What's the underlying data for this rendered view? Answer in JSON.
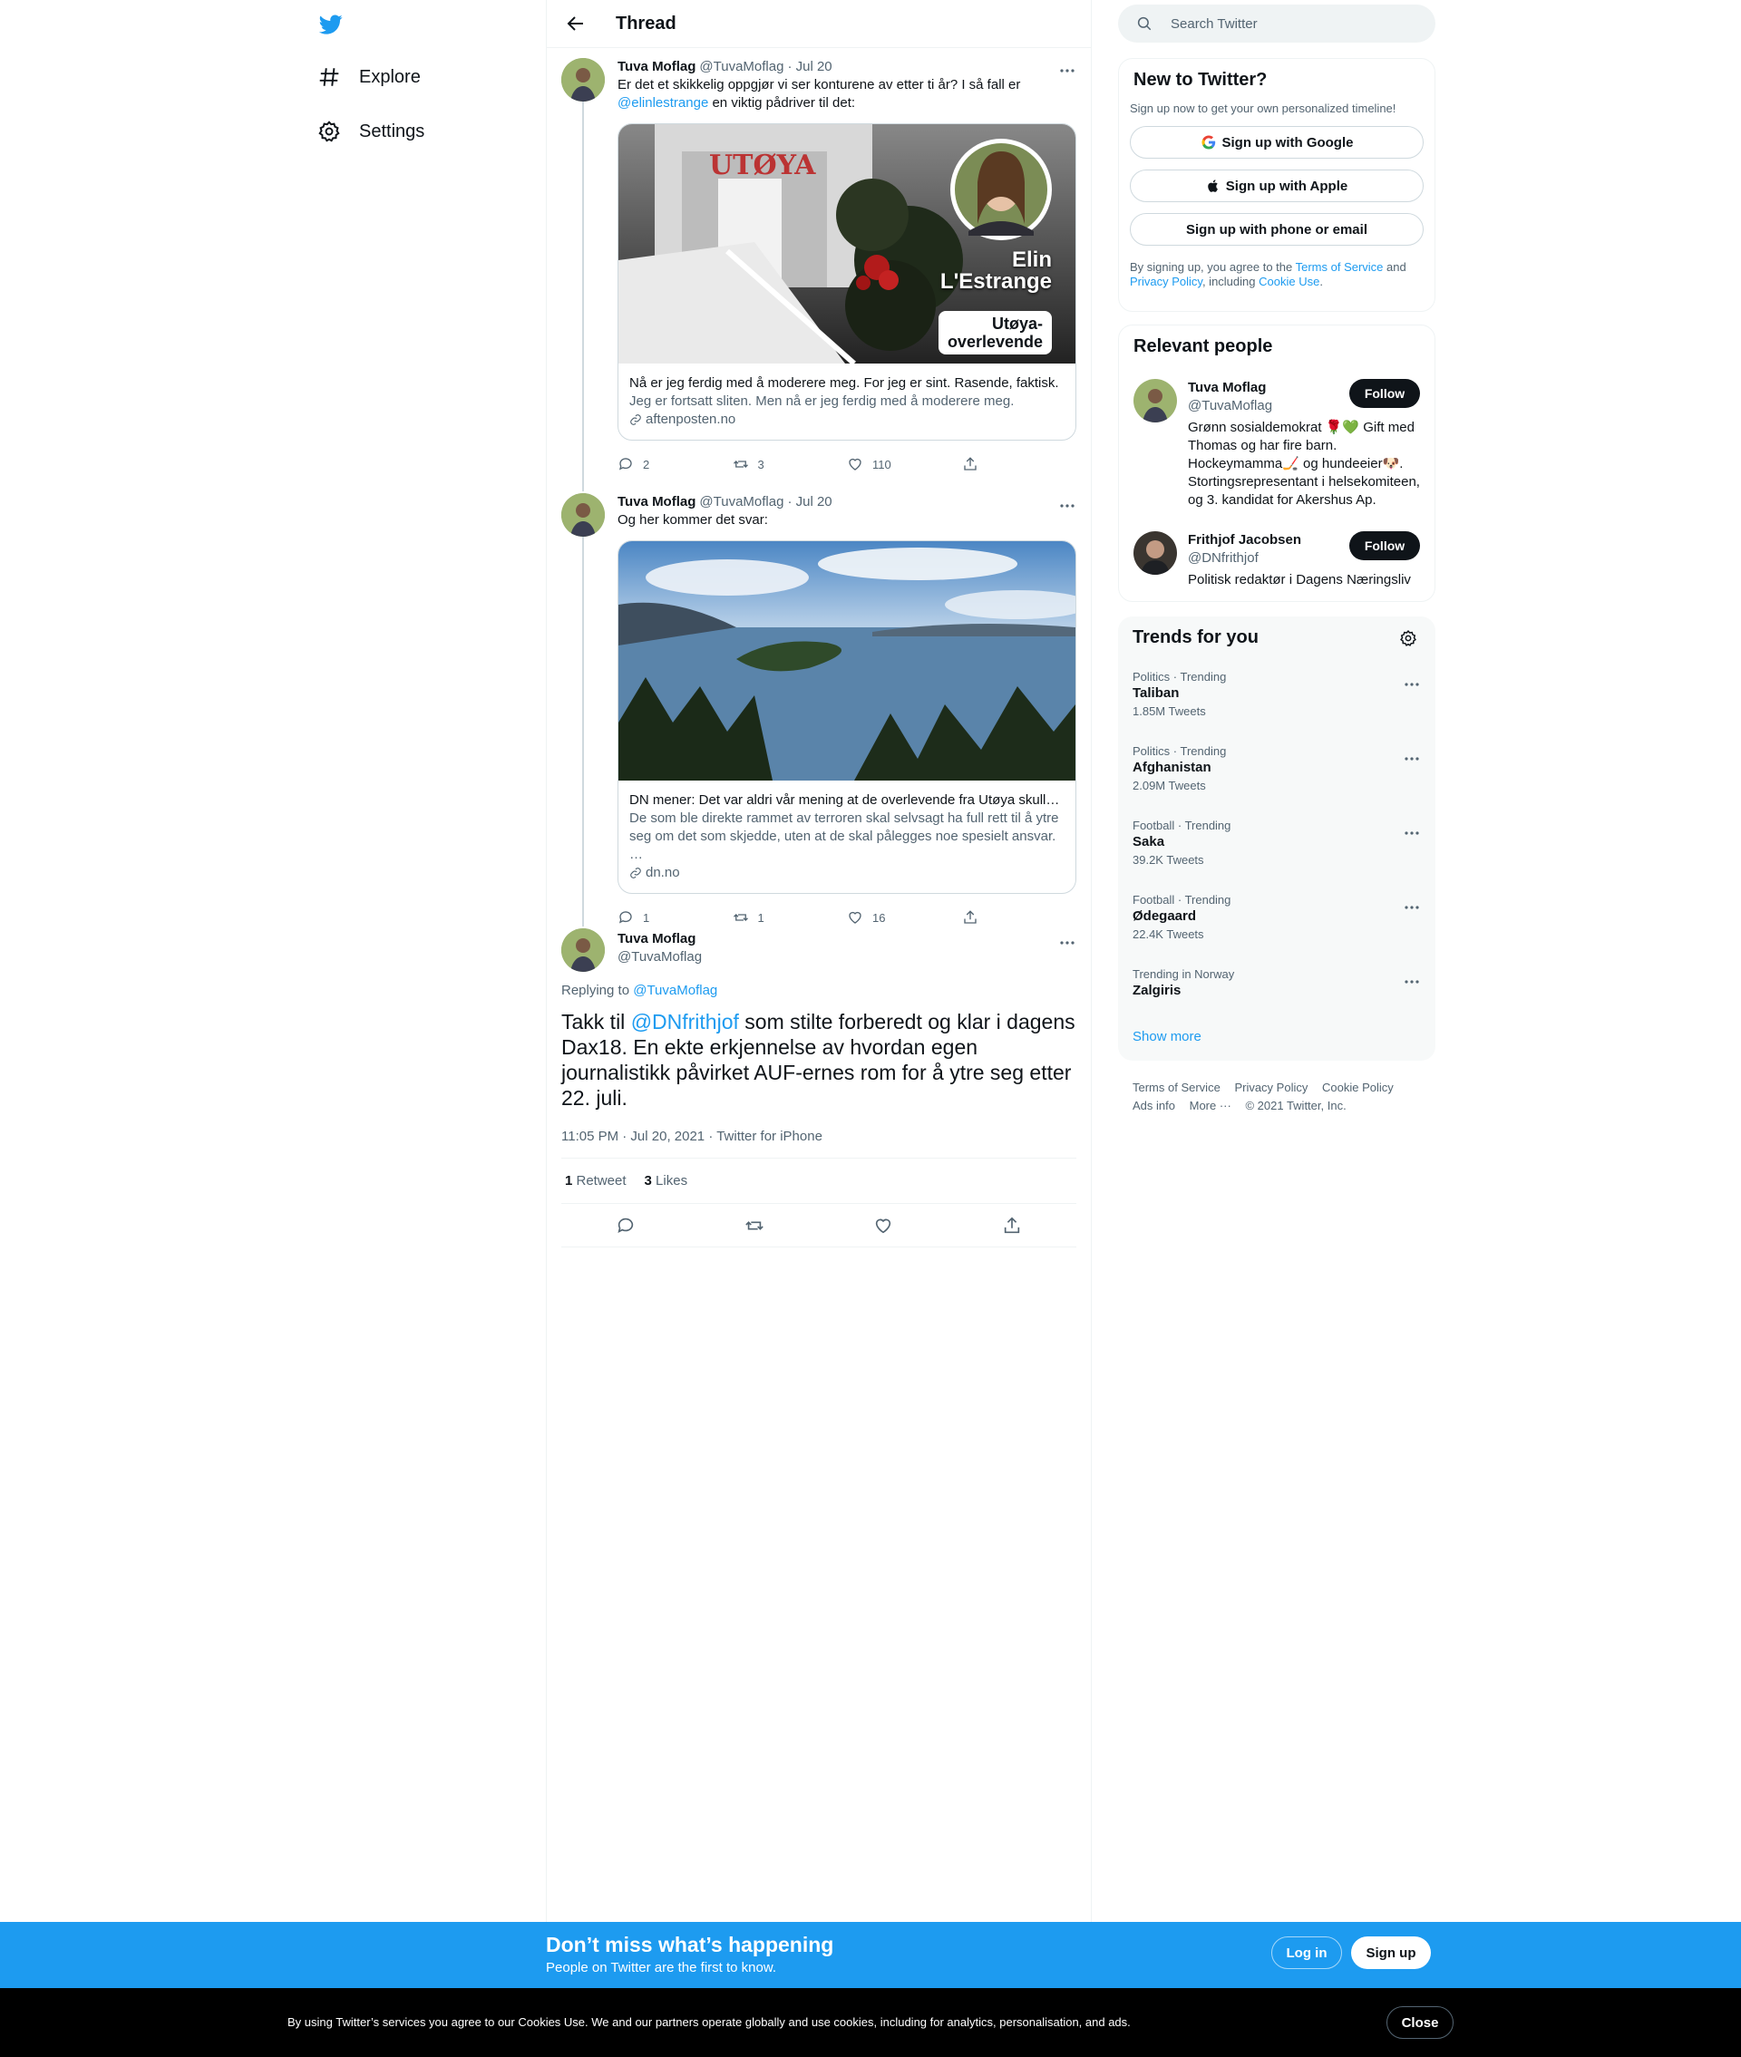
{
  "nav": {
    "explore": "Explore",
    "settings": "Settings"
  },
  "thread": {
    "title": "Thread",
    "tweets": [
      {
        "name": "Tuva Moflag",
        "handle": "@TuvaMoflag",
        "date": "· Jul 20",
        "text_before": "Er det et skikkelig oppgjør vi ser konturene av etter ti år? I så fall er",
        "mention": "@elinlestrange",
        "text_after": " en viktig pådriver til det:",
        "card": {
          "overlay_name_1": "Elin",
          "overlay_name_2": "L'Estrange",
          "overlay_tag_1": "Utøya-",
          "overlay_tag_2": "overlevende",
          "sign": "UTØYA",
          "title": "Nå er jeg ferdig med å moderere meg. For jeg er sint. Rasende, faktisk.",
          "desc": "Jeg er fortsatt sliten. Men nå er jeg ferdig med å moderere meg.",
          "domain": "aftenposten.no"
        },
        "replies": "2",
        "retweets": "3",
        "likes": "110"
      },
      {
        "name": "Tuva Moflag",
        "handle": "@TuvaMoflag",
        "date": "· Jul 20",
        "text": "Og her kommer det svar:",
        "card": {
          "title": "DN mener: Det var aldri vår mening at de overlevende fra Utøya skulle …",
          "desc": "De som ble direkte rammet av terroren skal selvsagt ha full rett til å ytre seg om det som skjedde, uten at de skal pålegges noe spesielt ansvar. …",
          "domain": "dn.no"
        },
        "replies": "1",
        "retweets": "1",
        "likes": "16"
      }
    ],
    "main_tweet": {
      "name": "Tuva Moflag",
      "handle": "@TuvaMoflag",
      "replying_label": "Replying to ",
      "replying_to": "@TuvaMoflag",
      "text_before": "Takk til ",
      "mention": "@DNfrithjof",
      "text_after": " som stilte forberedt og klar i dagens Dax18. En ekte erkjennelse av hvordan egen journalistikk påvirket AUF-ernes rom for å ytre seg etter 22. juli.",
      "meta": "11:05 PM · Jul 20, 2021 · Twitter for iPhone",
      "retweets_count": "1",
      "retweets_label": " Retweet",
      "likes_count": "3",
      "likes_label": " Likes"
    }
  },
  "search": {
    "placeholder": "Search Twitter"
  },
  "signup_panel": {
    "title": "New to Twitter?",
    "subtitle": "Sign up now to get your own personalized timeline!",
    "google": "Sign up with Google",
    "apple": "Sign up with Apple",
    "phone": "Sign up with phone or email",
    "legal_1": "By signing up, you agree to the ",
    "terms": "Terms of Service",
    "legal_2": " and ",
    "privacy": "Privacy Policy",
    "legal_3": ", including ",
    "cookie": "Cookie Use",
    "legal_4": "."
  },
  "relevant": {
    "title": "Relevant people",
    "follow_label": "Follow",
    "people": [
      {
        "name": "Tuva Moflag",
        "handle": "@TuvaMoflag",
        "bio": "Grønn sosialdemokrat 🌹💚 Gift med Thomas og har fire barn. Hockeymamma🏒 og hundeeier🐶. Stortingsrepresentant i helsekomiteen, og 3. kandidat for Akershus Ap."
      },
      {
        "name": "Frithjof Jacobsen",
        "handle": "@DNfrithjof",
        "bio": "Politisk redaktør i Dagens Næringsliv"
      }
    ]
  },
  "trends": {
    "title": "Trends for you",
    "items": [
      {
        "category": "Politics · Trending",
        "name": "Taliban",
        "count": "1.85M Tweets"
      },
      {
        "category": "Politics · Trending",
        "name": "Afghanistan",
        "count": "2.09M Tweets"
      },
      {
        "category": "Football · Trending",
        "name": "Saka",
        "count": "39.2K Tweets"
      },
      {
        "category": "Football · Trending",
        "name": "Ødegaard",
        "count": "22.4K Tweets"
      },
      {
        "category": "Trending in Norway",
        "name": "Zalgiris",
        "count": ""
      }
    ],
    "show_more": "Show more"
  },
  "footer": {
    "terms": "Terms of Service",
    "privacy": "Privacy Policy",
    "cookie": "Cookie Policy",
    "ads": "Ads info",
    "more": "More ···",
    "copyright": "© 2021 Twitter, Inc."
  },
  "bottom_bar": {
    "title": "Don’t miss what’s happening",
    "subtitle": "People on Twitter are the first to know.",
    "login": "Log in",
    "signup": "Sign up"
  },
  "cookie_bar": {
    "text": "By using Twitter’s services you agree to our Cookies Use. We and our partners operate globally and use cookies, including for analytics, personalisation, and ads.",
    "close": "Close"
  },
  "colors": {
    "accent": "#1d9bf0",
    "text": "#0f1419",
    "muted": "#536471"
  }
}
